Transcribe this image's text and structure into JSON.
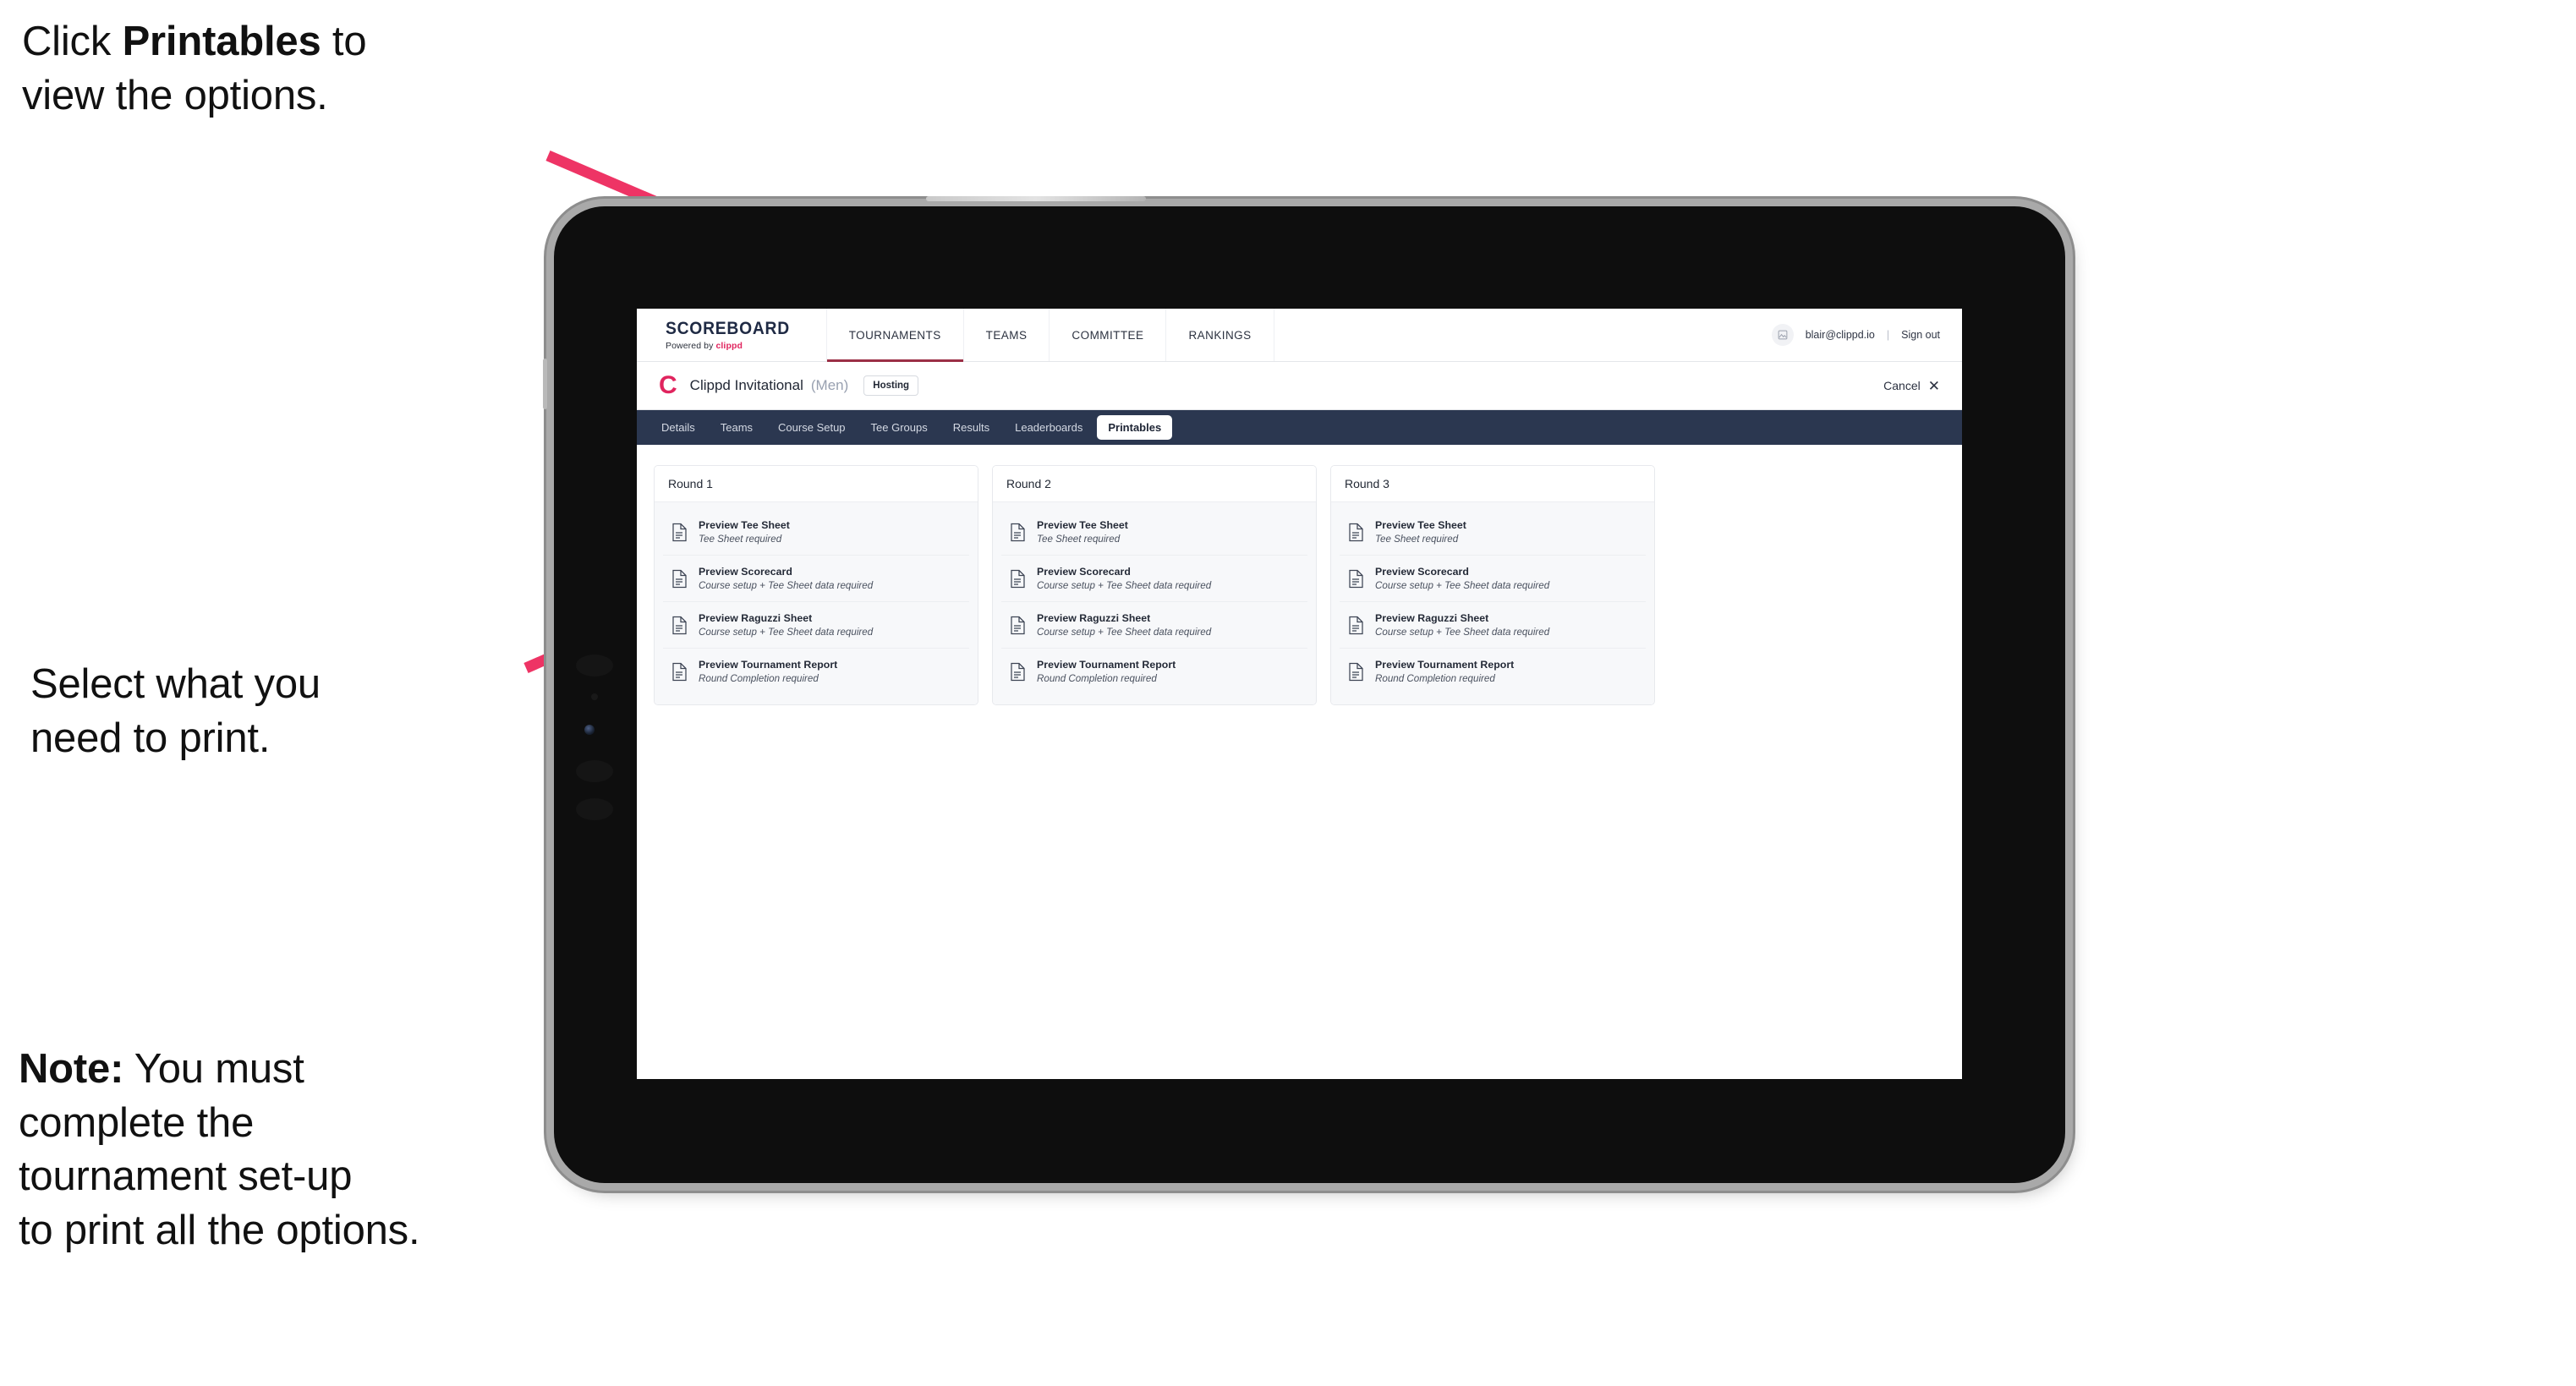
{
  "annotations": {
    "callout_top": {
      "prefix": "Click ",
      "bold": "Printables",
      "suffix": " to\nview the options."
    },
    "callout_middle": "Select what you\n need to print.",
    "callout_note": {
      "bold": "Note:",
      "rest": " You must\ncomplete the\ntournament set-up\nto print all the options."
    },
    "arrow_color": "#ee3465"
  },
  "app": {
    "brand": {
      "title": "SCOREBOARD",
      "powered_prefix": "Powered by ",
      "powered_name": "clippd"
    },
    "top_nav": [
      {
        "label": "TOURNAMENTS",
        "active": true
      },
      {
        "label": "TEAMS",
        "active": false
      },
      {
        "label": "COMMITTEE",
        "active": false
      },
      {
        "label": "RANKINGS",
        "active": false
      }
    ],
    "account": {
      "avatar_icon": "user-avatar-icon",
      "email": "blair@clippd.io",
      "separator": "|",
      "sign_out": "Sign out"
    },
    "tournament_bar": {
      "logo_letter": "C",
      "name": "Clippd Invitational",
      "gender": "(Men)",
      "badge": "Hosting",
      "cancel_label": "Cancel",
      "cancel_icon": "close-icon"
    },
    "sub_nav": [
      {
        "label": "Details",
        "active": false
      },
      {
        "label": "Teams",
        "active": false
      },
      {
        "label": "Course Setup",
        "active": false
      },
      {
        "label": "Tee Groups",
        "active": false
      },
      {
        "label": "Results",
        "active": false
      },
      {
        "label": "Leaderboards",
        "active": false
      },
      {
        "label": "Printables",
        "active": true
      }
    ],
    "rounds": [
      {
        "heading": "Round 1",
        "items": [
          {
            "icon": "document-icon",
            "title": "Preview Tee Sheet",
            "subtitle": "Tee Sheet required"
          },
          {
            "icon": "document-icon",
            "title": "Preview Scorecard",
            "subtitle": "Course setup + Tee Sheet data required"
          },
          {
            "icon": "document-icon",
            "title": "Preview Raguzzi Sheet",
            "subtitle": "Course setup + Tee Sheet data required"
          },
          {
            "icon": "document-icon",
            "title": "Preview Tournament Report",
            "subtitle": "Round Completion required"
          }
        ]
      },
      {
        "heading": "Round 2",
        "items": [
          {
            "icon": "document-icon",
            "title": "Preview Tee Sheet",
            "subtitle": "Tee Sheet required"
          },
          {
            "icon": "document-icon",
            "title": "Preview Scorecard",
            "subtitle": "Course setup + Tee Sheet data required"
          },
          {
            "icon": "document-icon",
            "title": "Preview Raguzzi Sheet",
            "subtitle": "Course setup + Tee Sheet data required"
          },
          {
            "icon": "document-icon",
            "title": "Preview Tournament Report",
            "subtitle": "Round Completion required"
          }
        ]
      },
      {
        "heading": "Round 3",
        "items": [
          {
            "icon": "document-icon",
            "title": "Preview Tee Sheet",
            "subtitle": "Tee Sheet required"
          },
          {
            "icon": "document-icon",
            "title": "Preview Scorecard",
            "subtitle": "Course setup + Tee Sheet data required"
          },
          {
            "icon": "document-icon",
            "title": "Preview Raguzzi Sheet",
            "subtitle": "Course setup + Tee Sheet data required"
          },
          {
            "icon": "document-icon",
            "title": "Preview Tournament Report",
            "subtitle": "Round Completion required"
          }
        ]
      }
    ]
  },
  "colors": {
    "accent_pink": "#e0245e",
    "subnav_bg": "#2b3750",
    "active_underline": "#9b2f46",
    "arrow": "#ee3465"
  }
}
